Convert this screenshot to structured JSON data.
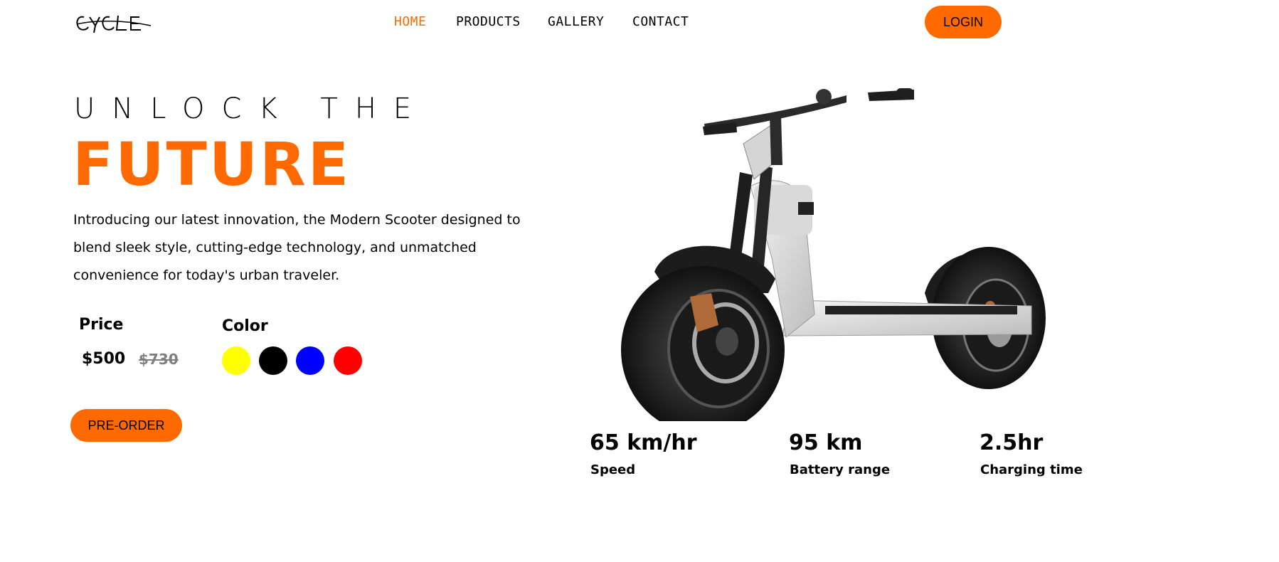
{
  "brand": {
    "logo_text": "CYCLE"
  },
  "nav": {
    "items": [
      {
        "label": "HOME",
        "active": true
      },
      {
        "label": "PRODUCTS",
        "active": false
      },
      {
        "label": "GALLERY",
        "active": false
      },
      {
        "label": "CONTACT",
        "active": false
      }
    ],
    "login_label": "LOGIN"
  },
  "hero": {
    "headline_top": "UNLOCK THE",
    "headline_main": "FUTURE",
    "intro_lines": [
      "Introducing our latest innovation, the Modern Scooter designed to",
      "blend sleek style, cutting-edge technology, and unmatched",
      "convenience for today's urban traveler."
    ]
  },
  "pricing": {
    "label": "Price",
    "current": "$500",
    "original": "$730"
  },
  "colors": {
    "label": "Color",
    "options": [
      {
        "name": "yellow",
        "hex": "#ffff00"
      },
      {
        "name": "black",
        "hex": "#000000"
      },
      {
        "name": "blue",
        "hex": "#0000ff"
      },
      {
        "name": "red",
        "hex": "#ff0000"
      }
    ]
  },
  "cta": {
    "preorder_label": "PRE-ORDER"
  },
  "stats": [
    {
      "value": "65 km/hr",
      "label": "Speed"
    },
    {
      "value": "95 km",
      "label": "Battery range"
    },
    {
      "value": "2.5hr",
      "label": "Charging time"
    }
  ],
  "theme": {
    "accent": "#ff6a00",
    "text": "#000000",
    "muted": "#808080"
  }
}
